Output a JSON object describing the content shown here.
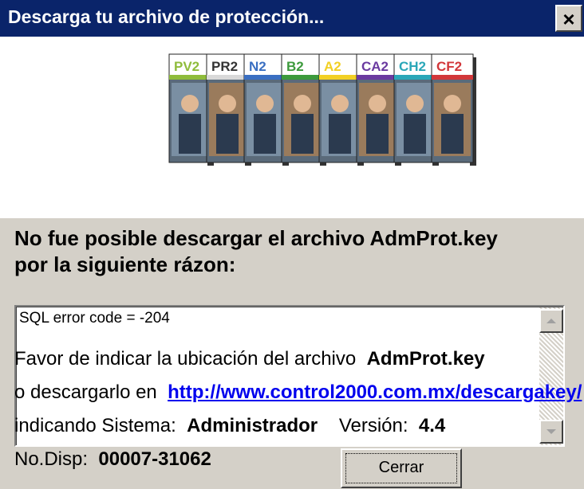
{
  "window": {
    "title": "Descarga tu archivo de protección...",
    "close_glyph": "×"
  },
  "banner": {
    "products": [
      {
        "label": "PV2",
        "color": "#8fbc3b"
      },
      {
        "label": "PR2",
        "color": "#d9d9d9"
      },
      {
        "label": "N2",
        "color": "#3a6fc2"
      },
      {
        "label": "B2",
        "color": "#3c9a3c"
      },
      {
        "label": "A2",
        "color": "#f2d024"
      },
      {
        "label": "CA2",
        "color": "#6a3aa0"
      },
      {
        "label": "CH2",
        "color": "#2aa7b8"
      },
      {
        "label": "CF2",
        "color": "#d2373a"
      }
    ]
  },
  "message": {
    "line1": "No fue posible descargar el archivo AdmProt.key",
    "line2": "por la siguiente rázon:"
  },
  "error_box": {
    "text": "SQL error code = -204"
  },
  "info": {
    "line1_prefix": "Favor de indicar la ubicación del archivo",
    "line1_file": "AdmProt.key",
    "line2_prefix": "o descargarlo en",
    "line2_link": "http://www.control2000.com.mx/descargakey/",
    "line3_prefix": "indicando Sistema:",
    "system_name": "Administrador",
    "version_label": "Versión:",
    "version_value": "4.4",
    "disp_label": "No.Disp:",
    "disp_value": "00007-31062"
  },
  "buttons": {
    "close_label": "Cerrar"
  }
}
